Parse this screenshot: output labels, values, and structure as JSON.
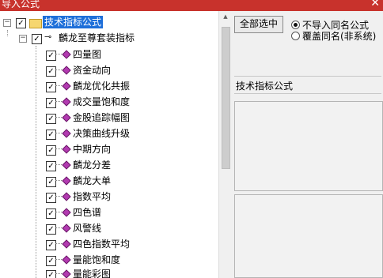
{
  "window": {
    "title": "导入公式",
    "close_glyph": "✕"
  },
  "tree": {
    "root": {
      "label": "技术指标公式",
      "checked": true
    },
    "group": {
      "label": "麟龙至尊套装指标",
      "checked": true
    },
    "items": [
      {
        "label": "四量图",
        "checked": true
      },
      {
        "label": "资金动向",
        "checked": true
      },
      {
        "label": "麟龙优化共振",
        "checked": true
      },
      {
        "label": "成交量饱和度",
        "checked": true
      },
      {
        "label": "金股追踪幅图",
        "checked": true
      },
      {
        "label": "决策曲线升级",
        "checked": true
      },
      {
        "label": "中期方向",
        "checked": true
      },
      {
        "label": "麟龙分差",
        "checked": true
      },
      {
        "label": "麟龙大单",
        "checked": true
      },
      {
        "label": "指数平均",
        "checked": true
      },
      {
        "label": "四色谱",
        "checked": true
      },
      {
        "label": "风警线",
        "checked": true
      },
      {
        "label": "四色指数平均",
        "checked": true
      },
      {
        "label": "量能饱和度",
        "checked": true
      },
      {
        "label": "量能彩图",
        "checked": true
      }
    ]
  },
  "options": {
    "select_all_label": "全部选中",
    "radio_no_import": "不导入同名公式",
    "radio_overwrite": "覆盖同名(非系统)",
    "selected_radio": "no_import"
  },
  "info": {
    "title": "技术指标公式"
  }
}
